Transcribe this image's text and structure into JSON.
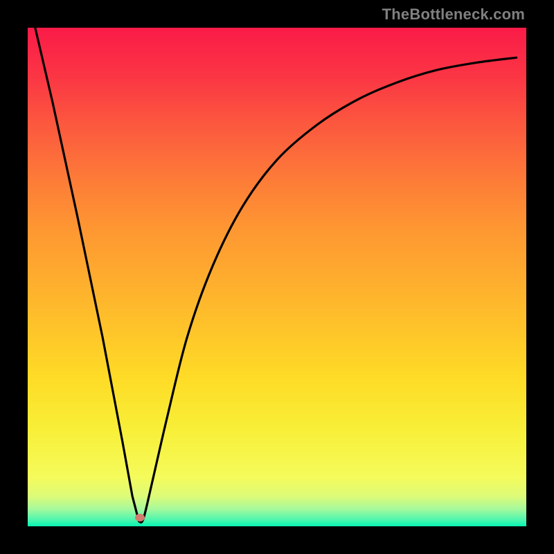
{
  "watermark": "TheBottleneck.com",
  "colors": {
    "frame": "#000000",
    "curve_stroke": "#000000",
    "marker": "#d27d6f",
    "watermark_text": "#808080"
  },
  "gradient_stops": [
    {
      "pos": 0.0,
      "color": "#fa1b48"
    },
    {
      "pos": 0.1,
      "color": "#fb3644"
    },
    {
      "pos": 0.2,
      "color": "#fc5a3e"
    },
    {
      "pos": 0.3,
      "color": "#fd7a38"
    },
    {
      "pos": 0.4,
      "color": "#fe9632"
    },
    {
      "pos": 0.5,
      "color": "#feac2e"
    },
    {
      "pos": 0.6,
      "color": "#fec32a"
    },
    {
      "pos": 0.7,
      "color": "#fedb26"
    },
    {
      "pos": 0.8,
      "color": "#f8ee37"
    },
    {
      "pos": 0.9,
      "color": "#f5fb5a"
    },
    {
      "pos": 0.94,
      "color": "#ddfb79"
    },
    {
      "pos": 0.965,
      "color": "#a6f99b"
    },
    {
      "pos": 0.985,
      "color": "#56f6ad"
    },
    {
      "pos": 1.0,
      "color": "#06f5b3"
    }
  ],
  "marker": {
    "x_frac": 0.225,
    "y_frac": 0.983
  },
  "chart_data": {
    "type": "line",
    "title": "",
    "xlabel": "",
    "ylabel": "",
    "x_range": [
      0,
      1
    ],
    "y_range": [
      0,
      1
    ],
    "series": [
      {
        "name": "curve",
        "points": [
          {
            "x": 0.015,
            "y": 1.0
          },
          {
            "x": 0.05,
            "y": 0.85
          },
          {
            "x": 0.1,
            "y": 0.62
          },
          {
            "x": 0.15,
            "y": 0.38
          },
          {
            "x": 0.19,
            "y": 0.17
          },
          {
            "x": 0.21,
            "y": 0.06
          },
          {
            "x": 0.223,
            "y": 0.01
          },
          {
            "x": 0.232,
            "y": 0.015
          },
          {
            "x": 0.25,
            "y": 0.09
          },
          {
            "x": 0.28,
            "y": 0.22
          },
          {
            "x": 0.32,
            "y": 0.38
          },
          {
            "x": 0.37,
            "y": 0.52
          },
          {
            "x": 0.43,
            "y": 0.64
          },
          {
            "x": 0.5,
            "y": 0.735
          },
          {
            "x": 0.58,
            "y": 0.805
          },
          {
            "x": 0.66,
            "y": 0.855
          },
          {
            "x": 0.74,
            "y": 0.89
          },
          {
            "x": 0.82,
            "y": 0.915
          },
          {
            "x": 0.9,
            "y": 0.93
          },
          {
            "x": 0.98,
            "y": 0.94
          }
        ]
      }
    ],
    "marker_point": {
      "x": 0.225,
      "y": 0.017
    }
  }
}
